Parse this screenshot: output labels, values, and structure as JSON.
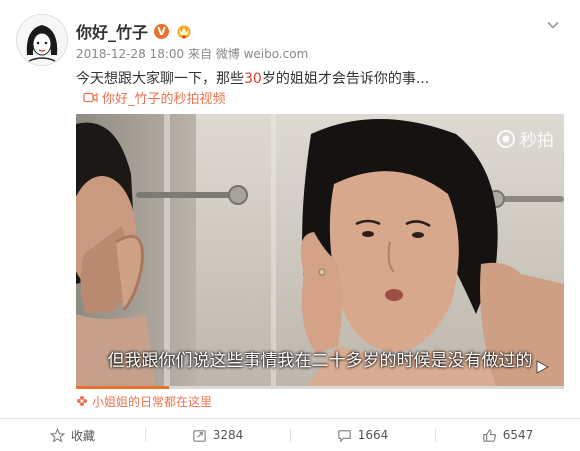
{
  "post": {
    "username": "你好_竹子",
    "verified_badge": "V",
    "meta": "2018-12-28 18:00 来自 微博 weibo.com",
    "text_before": "今天想跟大家聊一下，那些",
    "text_highlight": "30",
    "text_after": "岁的姐姐才会告诉你的事...",
    "video_link": "你好_竹子的秒拍视频"
  },
  "video": {
    "logo_text": "秒拍",
    "subtitle": "但我跟你们说这些事情我在二十多岁的时候是没有做过的",
    "progress": 0.19
  },
  "topic": "小姐姐的日常都在这里",
  "actions": {
    "favorite": "收藏",
    "repost": "3284",
    "comment": "1664",
    "like": "6547"
  },
  "colors": {
    "accent": "#eb7350",
    "highlight": "#e03b2f",
    "badge": "#e8722c"
  },
  "icons": [
    "avatar",
    "vip-badge-icon",
    "crown-icon",
    "chevron-down-icon",
    "video-camera-icon",
    "miaopai-logo-icon",
    "play-icon",
    "flower-icon",
    "star-icon",
    "repost-icon",
    "comment-icon",
    "like-icon"
  ]
}
